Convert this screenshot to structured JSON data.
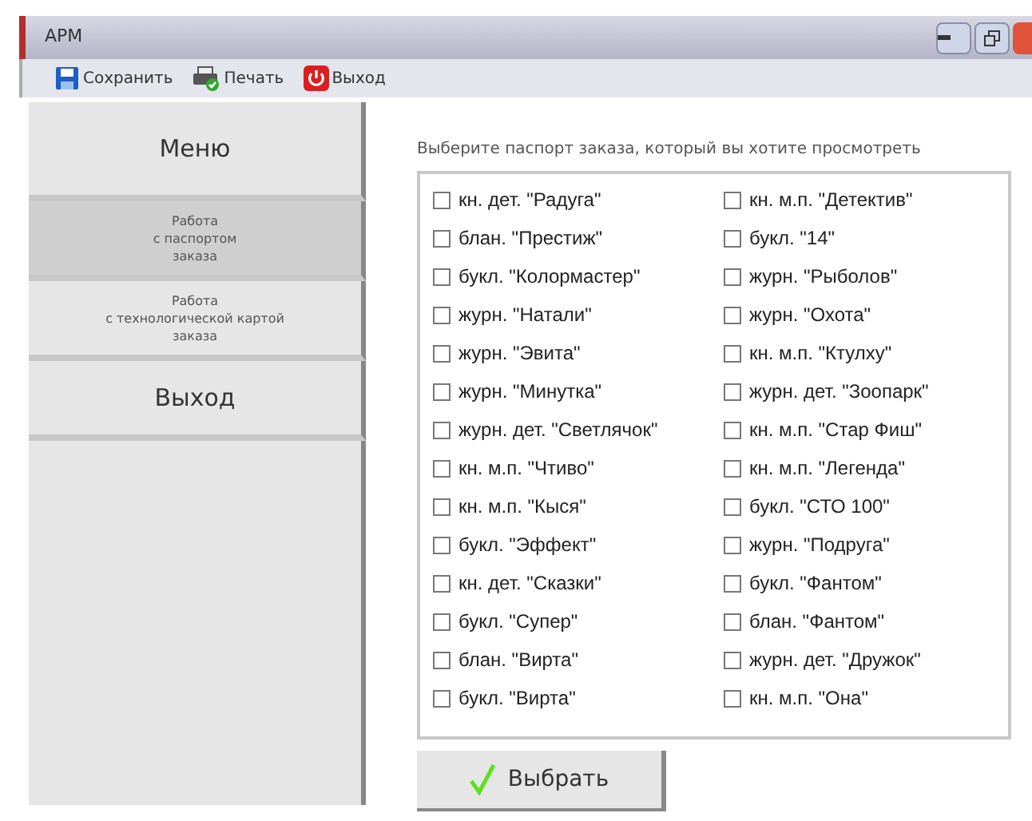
{
  "window": {
    "title": "АРМ"
  },
  "toolbar": [
    {
      "kind": "save",
      "label": "Сохранить"
    },
    {
      "kind": "print",
      "label": "Печать"
    },
    {
      "kind": "exit",
      "label": "Выход"
    }
  ],
  "sidebar": {
    "header": "Меню",
    "items": [
      {
        "kind": "small",
        "label": "Работа\nс паспортом\nзаказа",
        "selected": true
      },
      {
        "kind": "small",
        "label": "Работа\nс технологической картой\nзаказа",
        "selected": false
      },
      {
        "kind": "large",
        "label": "Выход",
        "selected": false
      }
    ]
  },
  "prompt": "Выберите паспорт заказа, который вы хотите просмотреть",
  "orders": [
    [
      {
        "label": "кн. дет. \"Радуга\"",
        "checked": false
      },
      {
        "label": "блан. \"Престиж\"",
        "checked": false
      },
      {
        "label": "букл. \"Колормастер\"",
        "checked": false
      },
      {
        "label": "журн. \"Натали\"",
        "checked": false
      },
      {
        "label": "журн. \"Эвита\"",
        "checked": false
      },
      {
        "label": "журн. \"Минутка\"",
        "checked": false
      },
      {
        "label": "журн. дет. \"Светлячок\"",
        "checked": false
      },
      {
        "label": "кн. м.п. \"Чтиво\"",
        "checked": false
      },
      {
        "label": "кн. м.п. \"Кыся\"",
        "checked": false
      },
      {
        "label": "букл. \"Эффект\"",
        "checked": false
      },
      {
        "label": "кн. дет. \"Сказки\"",
        "checked": false
      },
      {
        "label": "букл. \"Супер\"",
        "checked": false
      },
      {
        "label": "блан. \"Вирта\"",
        "checked": false
      },
      {
        "label": "букл. \"Вирта\"",
        "checked": false
      }
    ],
    [
      {
        "label": "кн. м.п. \"Детектив\"",
        "checked": false
      },
      {
        "label": "букл. \"14\"",
        "checked": false
      },
      {
        "label": "журн. \"Рыболов\"",
        "checked": false
      },
      {
        "label": "журн. \"Охота\"",
        "checked": false
      },
      {
        "label": "кн. м.п. \"Ктулху\"",
        "checked": false
      },
      {
        "label": "журн. дет. \"Зоопарк\"",
        "checked": false
      },
      {
        "label": "кн. м.п. \"Стар Фиш\"",
        "checked": false
      },
      {
        "label": "кн. м.п. \"Легенда\"",
        "checked": false
      },
      {
        "label": "букл. \"СТО 100\"",
        "checked": false
      },
      {
        "label": "журн. \"Подруга\"",
        "checked": false
      },
      {
        "label": "букл. \"Фантом\"",
        "checked": false
      },
      {
        "label": "блан. \"Фантом\"",
        "checked": false
      },
      {
        "label": "журн. дет. \"Дружок\"",
        "checked": false
      },
      {
        "label": "кн. м.п. \"Она\"",
        "checked": false
      }
    ]
  ],
  "select_button": "Выбрать"
}
